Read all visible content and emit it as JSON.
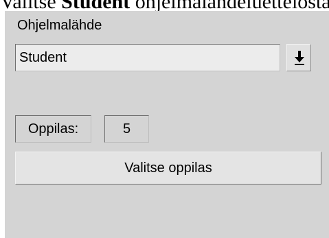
{
  "document_heading": {
    "part1": "Valitse ",
    "bold": "Student",
    "part2": " ohjelmalähdeluettelosta"
  },
  "panel": {
    "title": "Ohjelmalähde",
    "source_select": {
      "value": "Student"
    },
    "student_label": "Oppilas:",
    "student_number": "5",
    "select_button_label": "Valitse oppilas"
  },
  "icons": {
    "dropdown": "down-arrow-icon"
  }
}
